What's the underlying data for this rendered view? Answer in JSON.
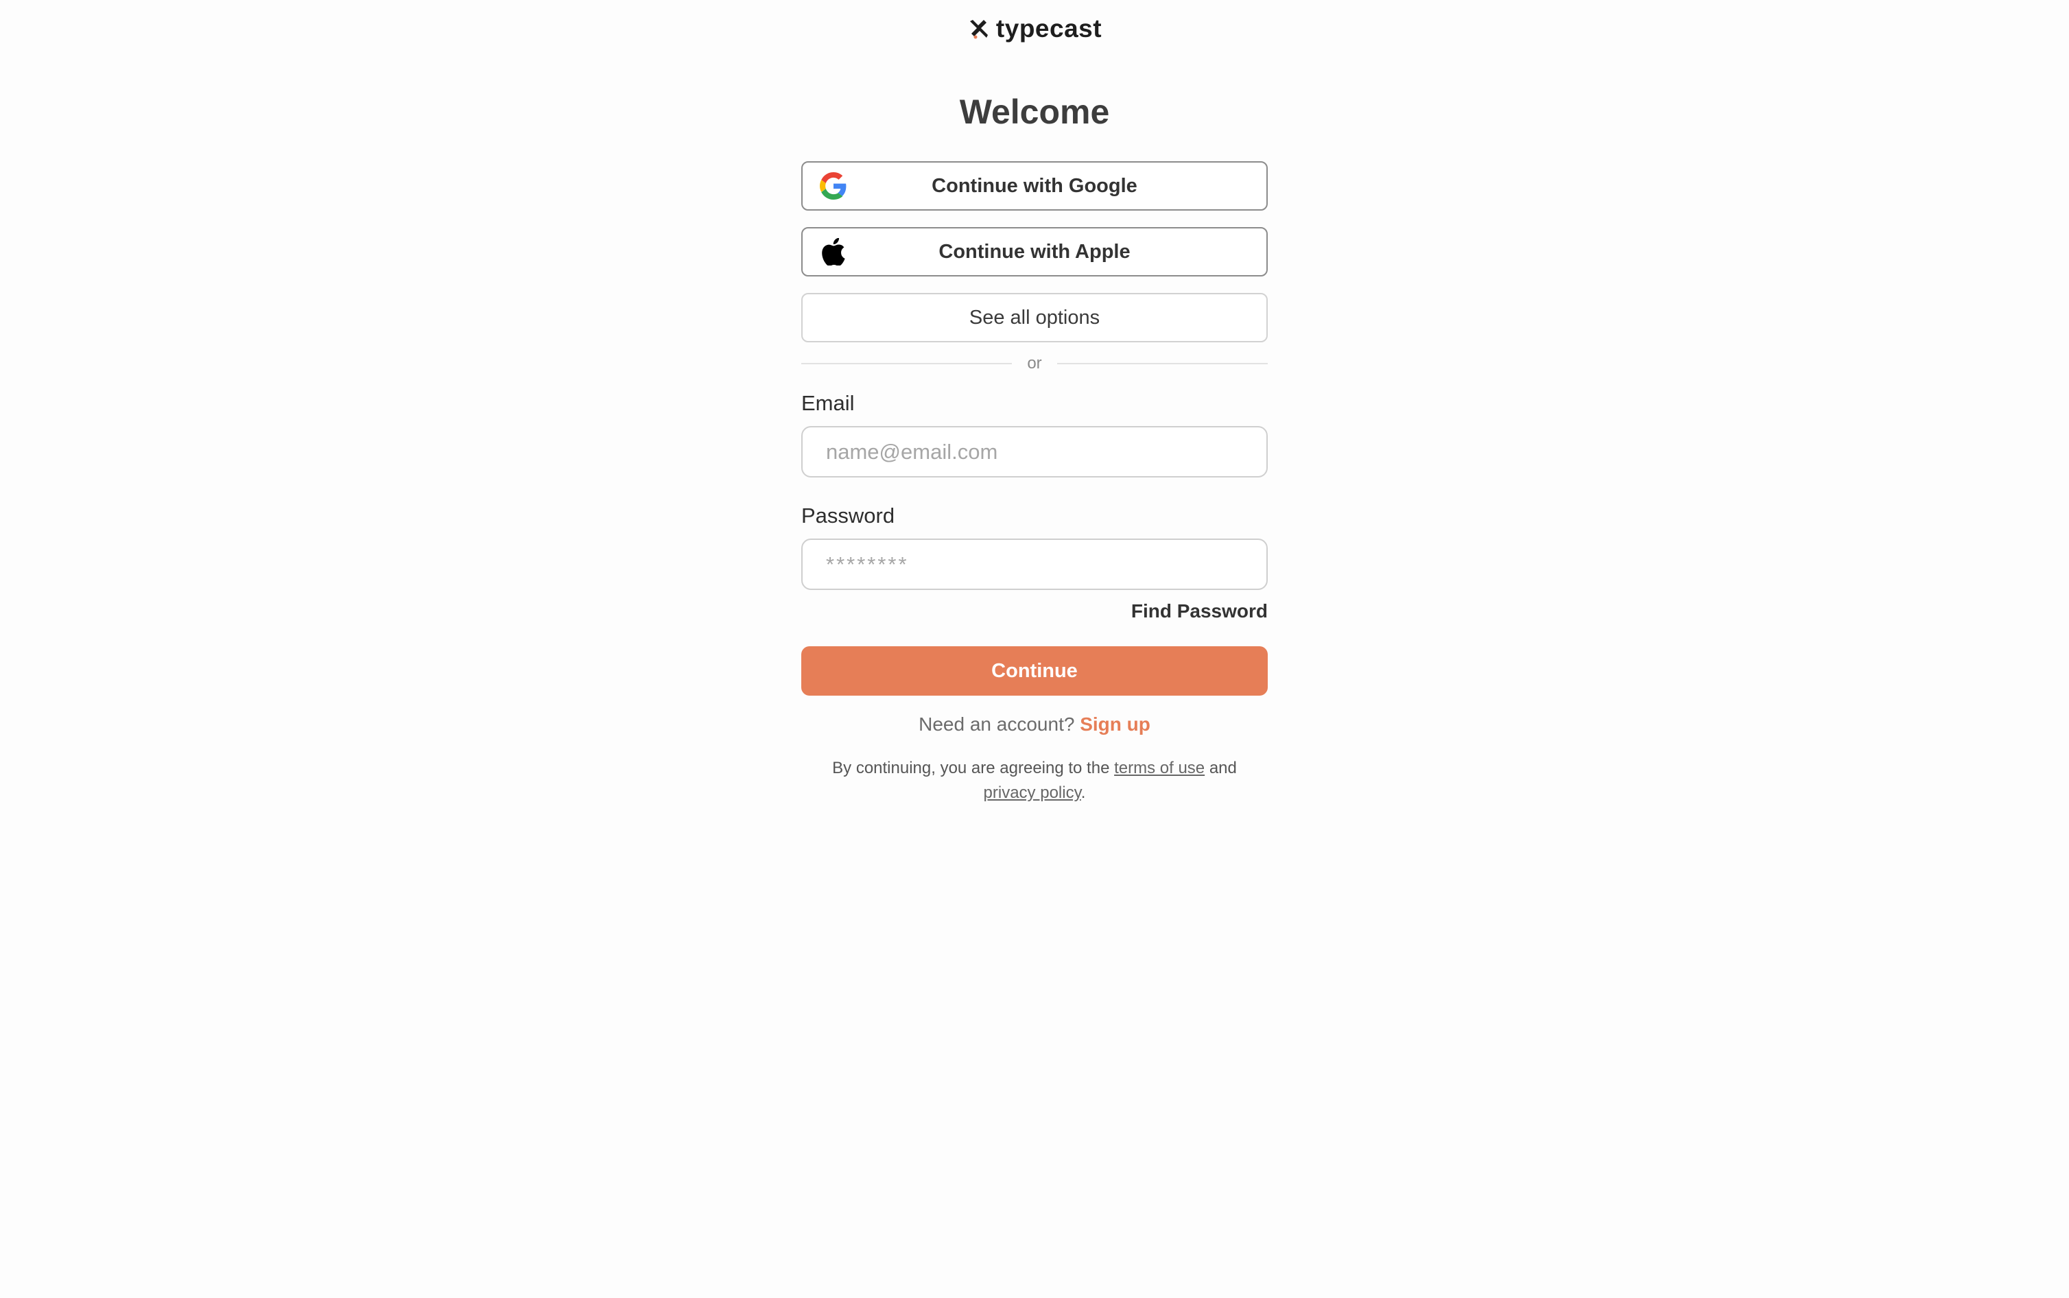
{
  "brand": {
    "logo_text": "typecast",
    "accent_color": "#e67e57"
  },
  "login": {
    "title": "Welcome",
    "google_label": "Continue with Google",
    "apple_label": "Continue with Apple",
    "options_label": "See all options",
    "divider_text": "or",
    "email_label": "Email",
    "email_placeholder": "name@email.com",
    "password_label": "Password",
    "password_placeholder": "********",
    "find_password_label": "Find Password",
    "continue_label": "Continue",
    "signup_prompt": "Need an account?",
    "signup_link": "Sign up",
    "legal": {
      "prefix": "By continuing, you are agreeing to the",
      "terms_link": "terms of use",
      "conjunction": "and",
      "privacy_link": "privacy policy",
      "suffix": "."
    }
  },
  "icons": {
    "logo": "typecast-logo-icon",
    "google": "google-icon",
    "apple": "apple-icon"
  }
}
